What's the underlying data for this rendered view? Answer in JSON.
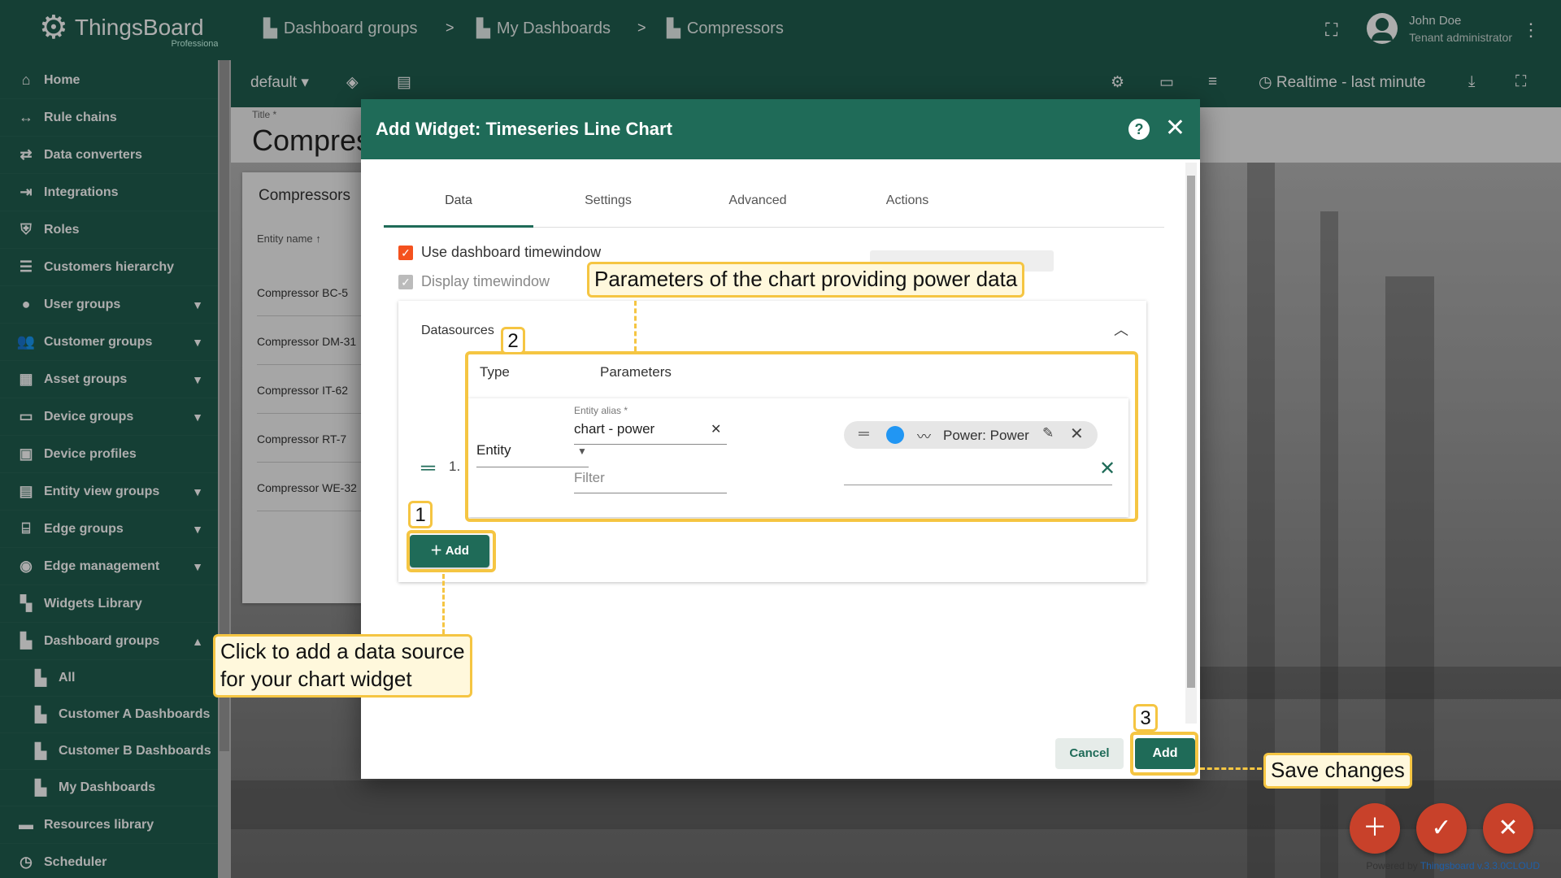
{
  "app": {
    "logo_name": "ThingsBoard",
    "logo_sub": "Professional"
  },
  "breadcrumb": [
    {
      "label": "Dashboard groups",
      "icon": "dashboard-grid-icon"
    },
    {
      "label": "My Dashboards",
      "icon": "dashboard-grid-icon"
    },
    {
      "label": "Compressors",
      "icon": "dashboard-grid-icon"
    }
  ],
  "breadcrumb_sep": ">",
  "user": {
    "name": "John Doe",
    "role": "Tenant administrator"
  },
  "sidebar": {
    "items": [
      {
        "label": "Home",
        "icon": "home-icon"
      },
      {
        "label": "Rule chains",
        "icon": "rule-chain-icon"
      },
      {
        "label": "Data converters",
        "icon": "converter-icon"
      },
      {
        "label": "Integrations",
        "icon": "integration-icon"
      },
      {
        "label": "Roles",
        "icon": "shield-icon"
      },
      {
        "label": "Customers hierarchy",
        "icon": "hierarchy-icon"
      },
      {
        "label": "User groups",
        "icon": "account-circle-icon",
        "expandable": true
      },
      {
        "label": "Customer groups",
        "icon": "people-icon",
        "expandable": true
      },
      {
        "label": "Asset groups",
        "icon": "building-icon",
        "expandable": true
      },
      {
        "label": "Device groups",
        "icon": "devices-icon",
        "expandable": true
      },
      {
        "label": "Device profiles",
        "icon": "device-profile-icon"
      },
      {
        "label": "Entity view groups",
        "icon": "view-icon",
        "expandable": true
      },
      {
        "label": "Edge groups",
        "icon": "router-icon",
        "expandable": true
      },
      {
        "label": "Edge management",
        "icon": "antenna-icon",
        "expandable": true
      },
      {
        "label": "Widgets Library",
        "icon": "widgets-icon"
      },
      {
        "label": "Dashboard groups",
        "icon": "dashboard-grid-icon",
        "expanded": true
      }
    ],
    "sub_items": [
      {
        "label": "All"
      },
      {
        "label": "Customer A Dashboards"
      },
      {
        "label": "Customer B Dashboards"
      },
      {
        "label": "My Dashboards"
      }
    ],
    "bottom_items": [
      {
        "label": "Resources library",
        "icon": "folder-icon"
      },
      {
        "label": "Scheduler",
        "icon": "clock-icon"
      }
    ]
  },
  "toolbar": {
    "state": "default",
    "timewindow": "Realtime - last minute"
  },
  "dashboard": {
    "title_label": "Title *",
    "title": "Compressors",
    "list_title": "Compressors",
    "column": "Entity name",
    "rows": [
      "Compressor BC-5",
      "Compressor DM-31",
      "Compressor IT-62",
      "Compressor RT-7",
      "Compressor WE-32"
    ]
  },
  "dialog": {
    "title": "Add Widget: Timeseries Line Chart",
    "tabs": [
      "Data",
      "Settings",
      "Advanced",
      "Actions"
    ],
    "use_dashboard_timewindow": "Use dashboard timewindow",
    "display_timewindow": "Display timewindow",
    "datasources_title": "Datasources",
    "col_type": "Type",
    "col_params": "Parameters",
    "row_index": "1.",
    "type_value": "Entity",
    "entity_alias_label": "Entity alias *",
    "entity_alias_value": "chart - power",
    "filter_placeholder": "Filter",
    "chip_label": "Power: Power",
    "add_label": "Add",
    "cancel_label": "Cancel",
    "submit_label": "Add"
  },
  "annotations": {
    "params_callout": "Parameters of the chart providing power data",
    "add_callout_line1": "Click to add a data source",
    "add_callout_line2": "for your chart widget",
    "save_callout": "Save changes",
    "num1": "1",
    "num2": "2",
    "num3": "3"
  },
  "footer": {
    "powered_prefix": "Powered by",
    "powered_link": "Thingsboard v.3.3.0CLOUD"
  },
  "colors": {
    "brand": "#1f5d4f",
    "accent": "#1f6b58",
    "highlight": "#f5c542",
    "fab": "#c8412a",
    "checkbox": "#f4511e"
  }
}
